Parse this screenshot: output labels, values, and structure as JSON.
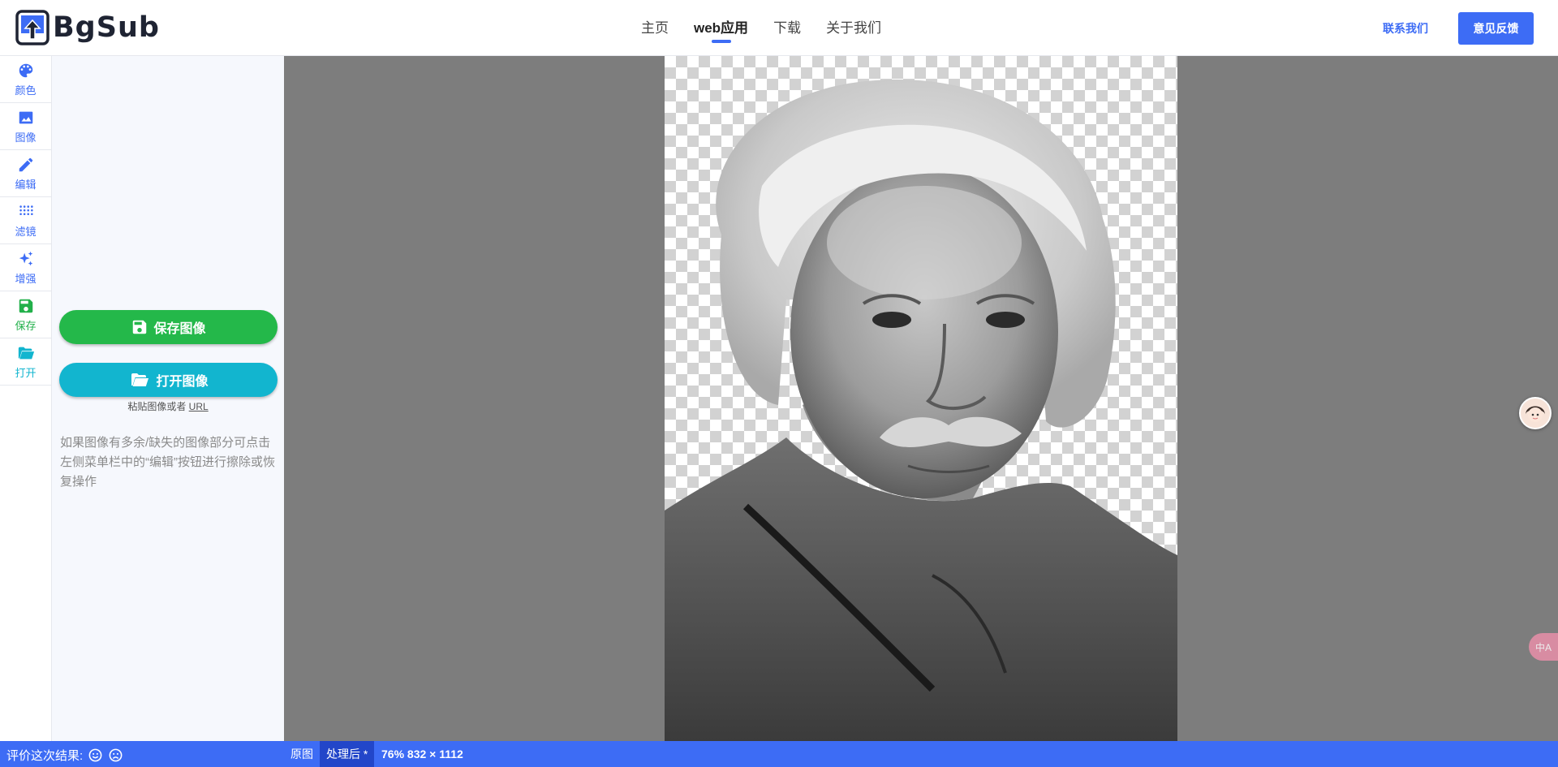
{
  "app": {
    "logo_text": "BgSub"
  },
  "nav": {
    "items": [
      "主页",
      "web应用",
      "下载",
      "关于我们"
    ],
    "active_index": 1
  },
  "header": {
    "contact_label": "联系我们",
    "feedback_label": "意见反馈"
  },
  "rail": {
    "items": [
      {
        "label": "颜色",
        "icon": "palette-icon",
        "color": "#3d6cf5"
      },
      {
        "label": "图像",
        "icon": "image-icon",
        "color": "#3d6cf5"
      },
      {
        "label": "编辑",
        "icon": "pencil-icon",
        "color": "#3d6cf5"
      },
      {
        "label": "滤镜",
        "icon": "dots-grid-icon",
        "color": "#3d6cf5"
      },
      {
        "label": "增强",
        "icon": "sparkles-icon",
        "color": "#3d6cf5"
      },
      {
        "label": "保存",
        "icon": "floppy-disk-icon",
        "color": "#22b04a"
      },
      {
        "label": "打开",
        "icon": "folder-open-icon",
        "color": "#12b5cf"
      }
    ]
  },
  "panel": {
    "save_button": "保存图像",
    "open_button": "打开图像",
    "paste_prefix": "粘贴图像或者",
    "paste_url": "URL",
    "hint": "如果图像有多余/缺失的图像部分可点击左侧菜单栏中的“编辑”按钮进行擦除或恢复操作"
  },
  "footer": {
    "rate_label": "评价这次结果:",
    "tab_original": "原图",
    "tab_processed": "处理后 *",
    "dimensions": "76% 832 × 1112"
  },
  "floats": {
    "translate_text": "中A"
  },
  "colors": {
    "accent": "#3d6cf5",
    "save_green": "#24b84a",
    "open_cyan": "#12b5cf",
    "canvas_gray": "#7d7d7d"
  }
}
